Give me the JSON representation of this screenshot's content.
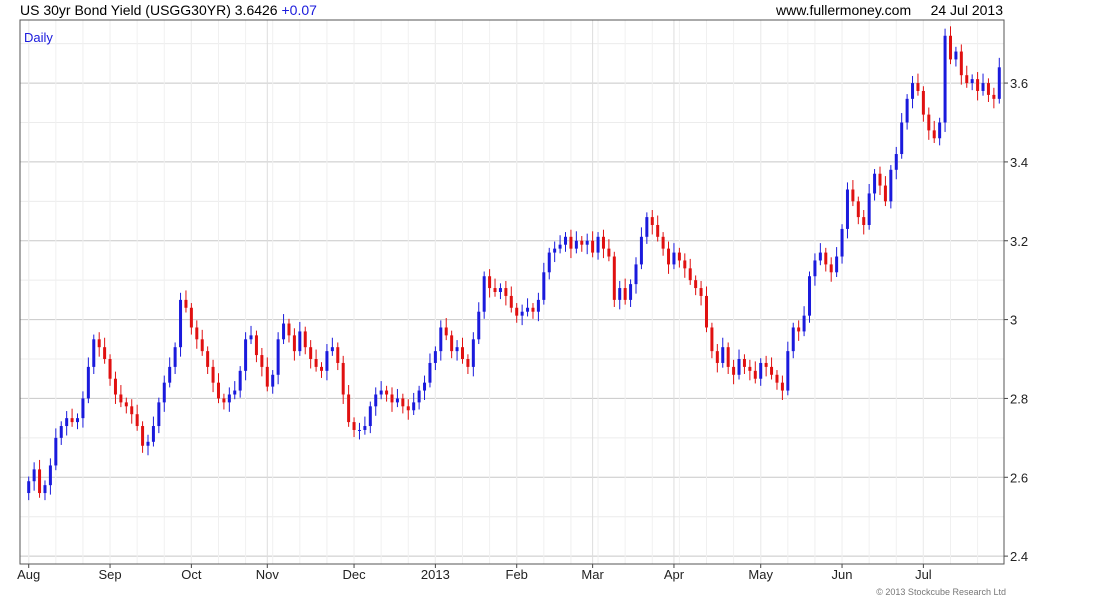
{
  "header": {
    "instrument": "US 30yr Bond Yield (USGG30YR)",
    "last": "3.6426",
    "change": "+0.07",
    "site": "www.fullermoney.com",
    "date": "24 Jul 2013"
  },
  "copyright": "© 2013 Stockcube Research Ltd",
  "chart_data": {
    "type": "candlestick",
    "period_label": "Daily",
    "x_ticks": [
      "Aug",
      "Sep",
      "Oct",
      "Nov",
      "Dec",
      "2013",
      "Feb",
      "Mar",
      "Apr",
      "May",
      "Jun",
      "Jul"
    ],
    "y_ticks": [
      "2.4",
      "2.6",
      "2.8",
      "3",
      "3.2",
      "3.4",
      "3.6"
    ],
    "ylim": [
      2.38,
      3.76
    ],
    "y_axis_side": "right",
    "grid": true,
    "colors": {
      "up": "#1a1adc",
      "down": "#e01010",
      "grid": "#d8d8d8"
    },
    "closes": [
      2.59,
      2.62,
      2.56,
      2.58,
      2.63,
      2.7,
      2.73,
      2.75,
      2.74,
      2.75,
      2.8,
      2.88,
      2.95,
      2.93,
      2.9,
      2.85,
      2.81,
      2.79,
      2.78,
      2.76,
      2.73,
      2.68,
      2.69,
      2.73,
      2.79,
      2.84,
      2.88,
      2.93,
      3.05,
      3.03,
      2.98,
      2.95,
      2.92,
      2.88,
      2.84,
      2.8,
      2.79,
      2.81,
      2.82,
      2.87,
      2.95,
      2.96,
      2.91,
      2.88,
      2.83,
      2.86,
      2.95,
      2.99,
      2.96,
      2.92,
      2.97,
      2.93,
      2.9,
      2.88,
      2.87,
      2.92,
      2.93,
      2.89,
      2.81,
      2.74,
      2.72,
      2.72,
      2.73,
      2.78,
      2.81,
      2.82,
      2.81,
      2.79,
      2.8,
      2.78,
      2.77,
      2.79,
      2.82,
      2.84,
      2.89,
      2.92,
      2.98,
      2.96,
      2.92,
      2.93,
      2.9,
      2.88,
      2.95,
      3.02,
      3.11,
      3.08,
      3.07,
      3.08,
      3.06,
      3.03,
      3.01,
      3.02,
      3.03,
      3.02,
      3.05,
      3.12,
      3.17,
      3.18,
      3.19,
      3.21,
      3.18,
      3.2,
      3.19,
      3.2,
      3.17,
      3.21,
      3.18,
      3.16,
      3.05,
      3.08,
      3.05,
      3.09,
      3.14,
      3.21,
      3.26,
      3.24,
      3.21,
      3.18,
      3.14,
      3.17,
      3.15,
      3.13,
      3.1,
      3.08,
      3.06,
      2.98,
      2.92,
      2.89,
      2.93,
      2.88,
      2.86,
      2.9,
      2.88,
      2.87,
      2.85,
      2.89,
      2.88,
      2.86,
      2.84,
      2.82,
      2.92,
      2.98,
      2.97,
      3.01,
      3.11,
      3.15,
      3.17,
      3.14,
      3.12,
      3.16,
      3.23,
      3.33,
      3.3,
      3.26,
      3.24,
      3.32,
      3.37,
      3.34,
      3.3,
      3.38,
      3.42,
      3.5,
      3.56,
      3.6,
      3.58,
      3.52,
      3.48,
      3.46,
      3.5,
      3.72,
      3.66,
      3.68,
      3.62,
      3.6,
      3.61,
      3.58,
      3.6,
      3.57,
      3.56,
      3.64
    ]
  }
}
